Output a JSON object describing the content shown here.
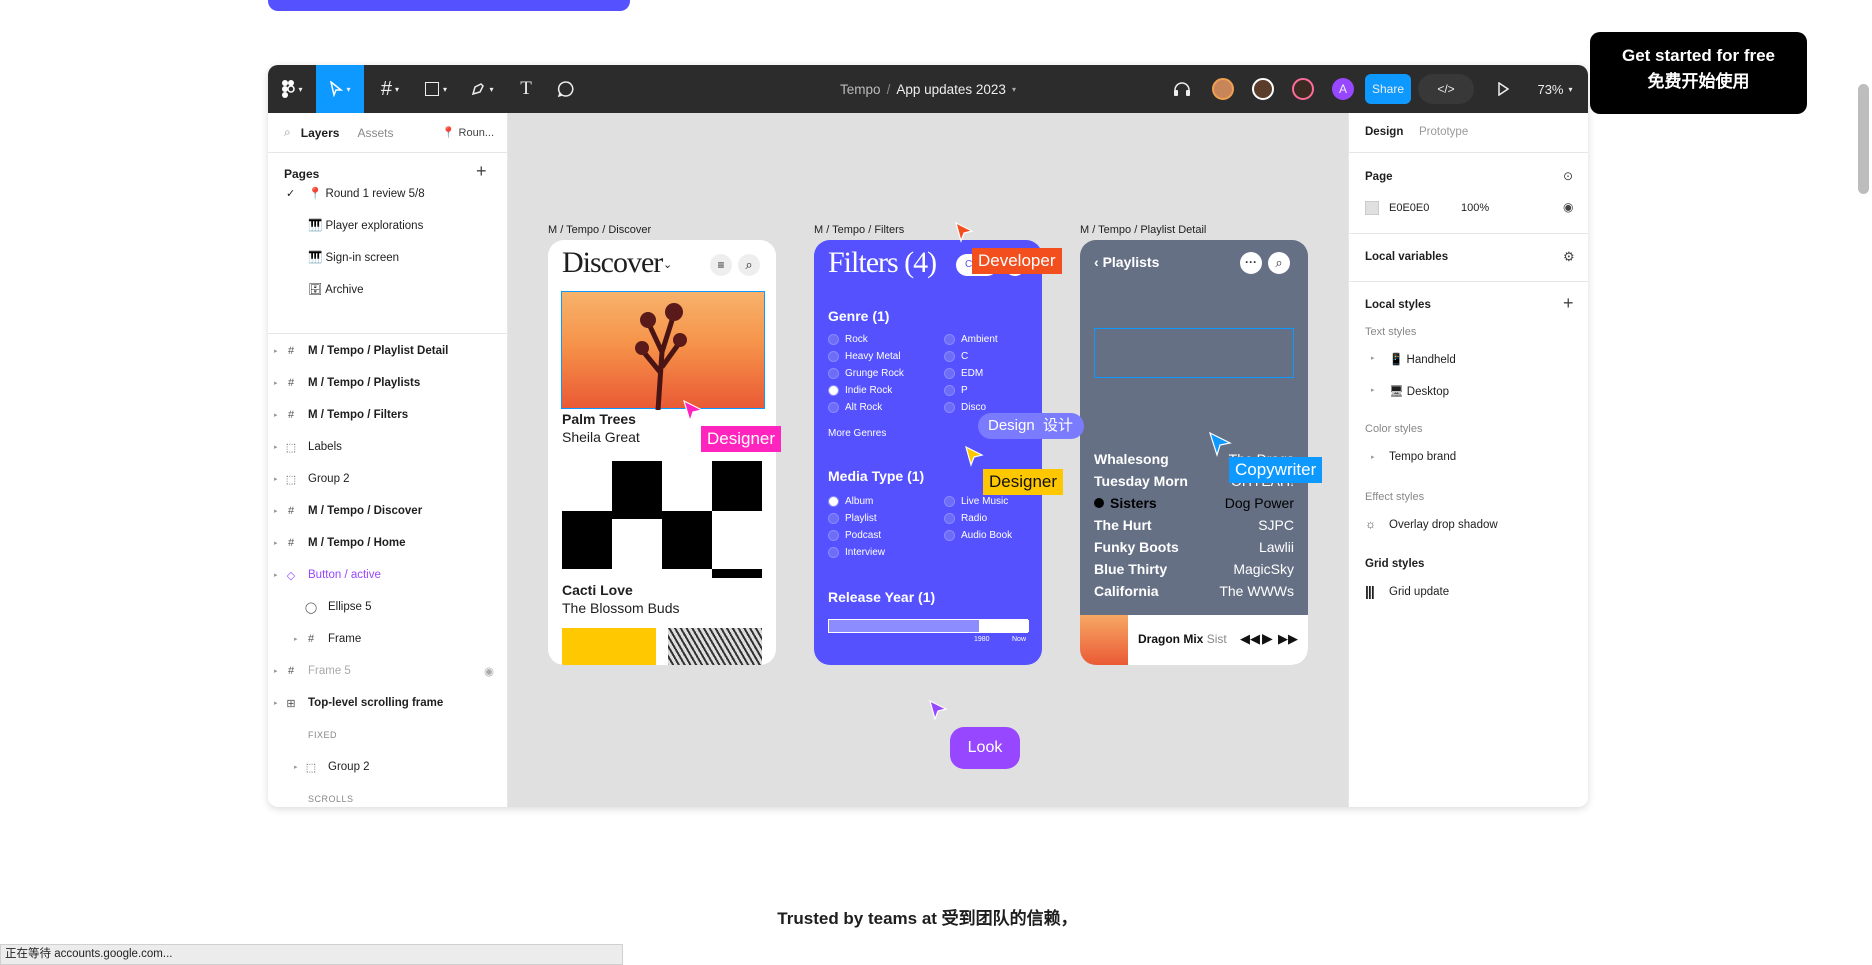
{
  "cta": {
    "line1": "Get started for free",
    "line2": "免费开始使用"
  },
  "trusted": "Trusted by teams at 受到团队的信赖，",
  "status_bar": "正在等待 accounts.google.com...",
  "toolbar": {
    "project": "Tempo",
    "separator": "/",
    "file": "App updates 2023",
    "avatar_letter": "A",
    "share": "Share",
    "zoom": "73%"
  },
  "left_panel": {
    "tabs": {
      "layers": "Layers",
      "assets": "Assets",
      "page_picker": "📍 Roun..."
    },
    "pages_title": "Pages",
    "pages": [
      {
        "label": "📍 Round 1 review 5/8",
        "check": "✓"
      },
      {
        "label": "🎹 Player explorations"
      },
      {
        "label": "🎹 Sign-in screen"
      },
      {
        "label": "🗄 Archive"
      }
    ],
    "layers": [
      {
        "label": "M / Tempo / Playlist Detail",
        "icon": "#"
      },
      {
        "label": "M / Tempo / Playlists",
        "icon": "#"
      },
      {
        "label": "M / Tempo / Filters",
        "icon": "#"
      },
      {
        "label": "Labels",
        "icon": "⬚"
      },
      {
        "label": "Group 2",
        "icon": "⬚"
      },
      {
        "label": "M / Tempo / Discover",
        "icon": "#"
      },
      {
        "label": "M / Tempo / Home",
        "icon": "#"
      },
      {
        "label": "Button / active",
        "icon": "◇"
      },
      {
        "label": "Ellipse 5",
        "icon": "◯"
      },
      {
        "label": "Frame",
        "icon": "#"
      },
      {
        "label": "Frame 5",
        "icon": "#"
      },
      {
        "label": "Top-level scrolling frame",
        "icon": "⊞"
      },
      {
        "label": "FIXED",
        "icon": ""
      },
      {
        "label": "Group 2",
        "icon": "⬚"
      },
      {
        "label": "SCROLLS",
        "icon": ""
      },
      {
        "label": "Group 2",
        "icon": "⬚"
      }
    ]
  },
  "right_panel": {
    "tabs": {
      "design": "Design",
      "prototype": "Prototype"
    },
    "page": {
      "title": "Page",
      "color": "E0E0E0",
      "opacity": "100%"
    },
    "local_variables": "Local variables",
    "local_styles": "Local styles",
    "text_styles": {
      "title": "Text styles",
      "items": [
        "📱 Handheld",
        "🖥 Desktop"
      ]
    },
    "color_styles": {
      "title": "Color styles",
      "items": [
        "Tempo brand"
      ]
    },
    "effect_styles": {
      "title": "Effect styles",
      "items": [
        "Overlay drop shadow"
      ]
    },
    "grid_styles": {
      "title": "Grid styles",
      "items": [
        "Grid update"
      ]
    }
  },
  "frames": {
    "discover": {
      "label": "M / Tempo / Discover",
      "title": "Discover",
      "tracks": [
        {
          "title": "Palm Trees",
          "artist": "Sheila Great"
        },
        {
          "title": "Cacti Love",
          "artist": "The Blossom Buds"
        }
      ]
    },
    "filters": {
      "label": "M / Tempo / Filters",
      "title": "Filters (4)",
      "clear": "Clear",
      "genre_title": "Genre (1)",
      "genres_left": [
        "Rock",
        "Heavy Metal",
        "Grunge Rock",
        "Indie Rock",
        "Alt Rock"
      ],
      "genres_right": [
        "Ambient",
        "C",
        "EDM",
        "P",
        "Disco"
      ],
      "more": "More Genres",
      "media_title": "Media Type (1)",
      "media_left": [
        "Album",
        "Playlist",
        "Podcast",
        "Interview"
      ],
      "media_right": [
        "Live Music",
        "Radio",
        "Audio Book"
      ],
      "year_title": "Release Year (1)",
      "year_from": "1980",
      "year_to": "Now"
    },
    "playlist": {
      "label": "M / Tempo / Playlist Detail",
      "back": "Playlists",
      "rows": [
        {
          "song": "Whalesong",
          "artist": "The Drags"
        },
        {
          "song": "Tuesday Morn",
          "artist": "OHYEAH!"
        },
        {
          "song": "Sisters",
          "artist": "Dog Power"
        },
        {
          "song": "The Hurt",
          "artist": "SJPC"
        },
        {
          "song": "Funky Boots",
          "artist": "Lawlii"
        },
        {
          "song": "Blue Thirty",
          "artist": "MagicSky"
        },
        {
          "song": "California",
          "artist": "The WWWs"
        }
      ],
      "now_playing": "Dragon Mix",
      "now_playing_artist": "Sist"
    }
  },
  "cursors": {
    "developer": "Developer",
    "designer1": "Designer",
    "designer2": "Designer",
    "copywriter": "Copywriter",
    "design_chip": "Design  设计",
    "look": "Look"
  },
  "colors": {
    "accent": "#0d99ff",
    "filters_bg": "#5551ff",
    "playlist_bg": "#667085",
    "developer": "#f24e1e",
    "designer_pink": "#ff24bd",
    "designer_yellow": "#ffc700",
    "look": "#9747ff"
  }
}
